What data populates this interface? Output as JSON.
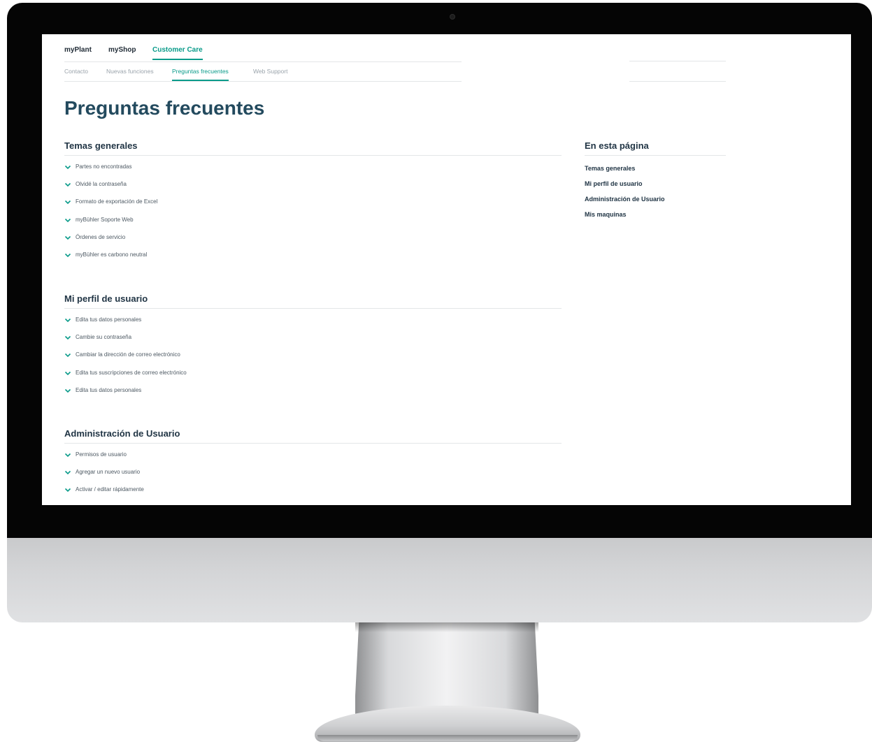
{
  "top_nav": [
    {
      "label": "myPlant",
      "active": false
    },
    {
      "label": "myShop",
      "active": false
    },
    {
      "label": "Customer Care",
      "active": true
    }
  ],
  "sub_nav": [
    {
      "label": "Contacto",
      "active": false
    },
    {
      "label": "Nuevas funciones",
      "active": false
    },
    {
      "label": "Preguntas frecuentes",
      "active": true
    },
    {
      "label": "Web Support",
      "active": false
    }
  ],
  "page_title": "Preguntas frecuentes",
  "sections": [
    {
      "title": "Temas generales",
      "items": [
        "Partes no encontradas",
        "Olvidé la contraseña",
        "Formato de exportación de Excel",
        "myBühler Soporte Web",
        "Órdenes de servicio",
        "myBühler es carbono neutral"
      ]
    },
    {
      "title": "Mi perfil de usuario",
      "items": [
        "Edita tus datos personales",
        "Cambie su contraseña",
        "Cambiar la dirección de correo electrónico",
        "Edita tus suscripciones de correo electrónico",
        "Edita tus datos personales"
      ]
    },
    {
      "title": "Administración de Usuario",
      "items": [
        "Permisos de usuario",
        "Agregar un nuevo usuario",
        "Activar / editar rápidamente"
      ]
    }
  ],
  "toc": {
    "title": "En esta página",
    "items": [
      "Temas generales",
      "Mi perfil de usuario",
      "Administración de Usuario",
      "Mis maquinas"
    ]
  },
  "colors": {
    "accent": "#0a9b8a",
    "title": "#234a5e",
    "heading": "#213545"
  },
  "icons": {
    "faq_toggle": "chevron-down-icon",
    "camera": "camera-dot"
  }
}
